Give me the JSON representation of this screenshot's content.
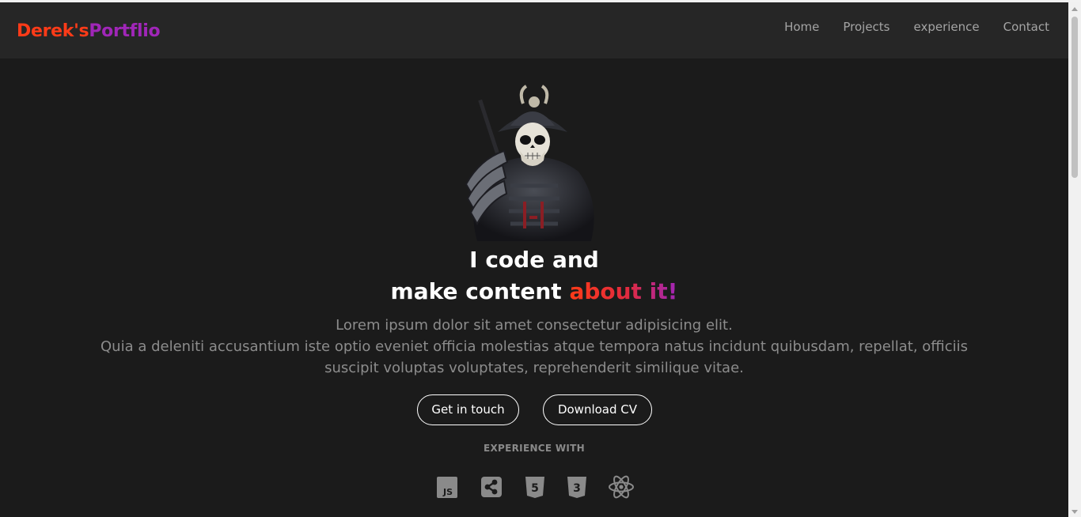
{
  "brand": {
    "part1": "Derek's",
    "part2": "Portflio",
    "color1": "#ff3b18",
    "color2": "#a026b8"
  },
  "nav": {
    "items": [
      "Home",
      "Projects",
      "experience",
      "Contact"
    ]
  },
  "hero": {
    "line1": "I code and",
    "line2_prefix": "make content ",
    "line2_highlight": "about it!",
    "desc_line1": "Lorem ipsum dolor sit amet consectetur adipisicing elit.",
    "desc_line2": "Quia a deleniti accusantium iste optio eveniet officia molestias atque tempora natus incidunt quibusdam, repellat, officiis suscipit voluptas voluptates, reprehenderit similique vitae."
  },
  "buttons": {
    "contact": "Get in touch",
    "cv": "Download CV"
  },
  "experience": {
    "heading": "EXPERIENCE WITH",
    "icons": [
      "javascript-icon",
      "share-icon",
      "html5-icon",
      "css3-icon",
      "react-icon"
    ]
  },
  "colors": {
    "background": "#1b1b1b",
    "navbar": "#262626",
    "accent": "#ff3b18",
    "accent2": "#a026b8"
  }
}
